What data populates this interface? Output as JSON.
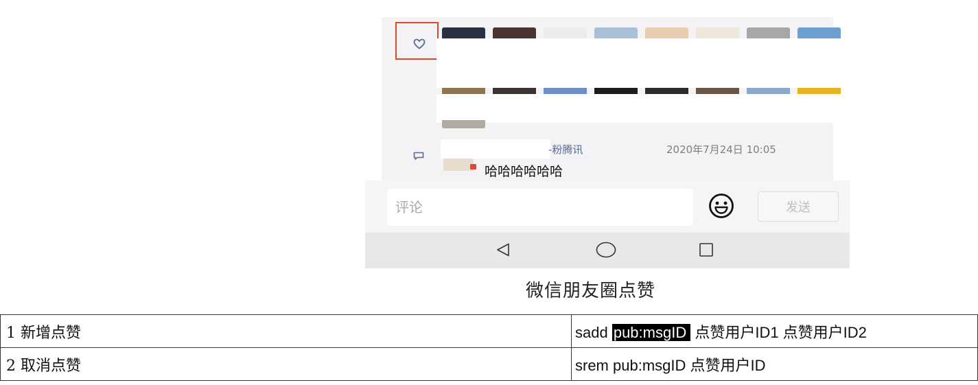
{
  "phone": {
    "comment": {
      "name": "-粉腾讯",
      "time": "2020年7月24日 10:05",
      "text": "哈哈哈哈哈哈"
    },
    "input_placeholder": "评论",
    "send_label": "发送",
    "icons": [
      "heart-icon",
      "comment-icon",
      "emoji-icon",
      "nav-back-icon",
      "nav-home-icon",
      "nav-recents-icon"
    ],
    "colors": {
      "highlight_box": "#e0452f",
      "name_link": "#576b95"
    }
  },
  "caption": "微信朋友圈点赞",
  "table": {
    "rows": [
      {
        "action": "1 新增点赞",
        "command_prefix": "sadd ",
        "command_key": "pub:msgID",
        "command_suffix": " 点赞用户ID1  点赞用户ID2"
      },
      {
        "action": "2 取消点赞",
        "command": "srem pub:msgID  点赞用户ID"
      }
    ]
  }
}
